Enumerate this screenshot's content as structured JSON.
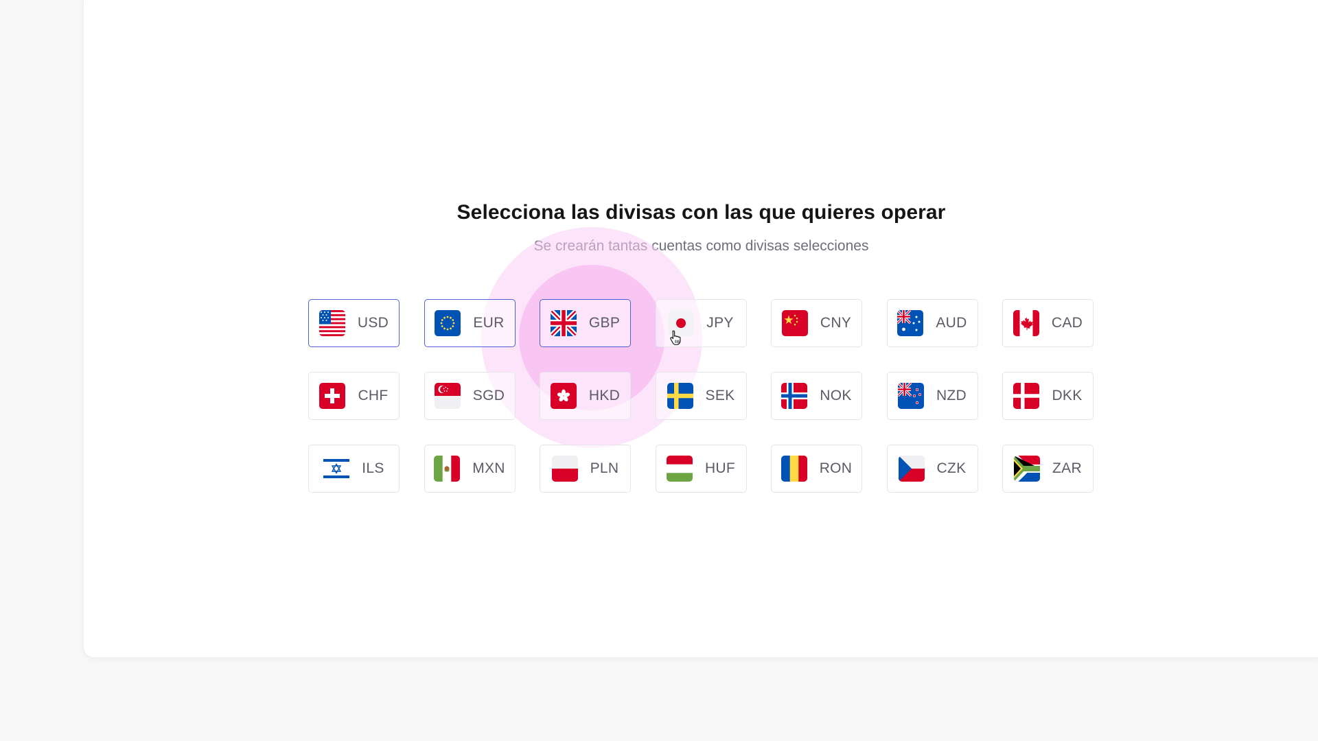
{
  "page": {
    "title": "Selecciona las divisas con las que quieres operar",
    "subtitle": "Se crearán tantas cuentas como divisas selecciones"
  },
  "colors": {
    "accent": "#4f5fd8",
    "highlight": "#f8b4f0"
  },
  "currencies": [
    {
      "code": "USD",
      "flag": "us-flag-icon",
      "selected": true
    },
    {
      "code": "EUR",
      "flag": "eu-flag-icon",
      "selected": true
    },
    {
      "code": "GBP",
      "flag": "gb-flag-icon",
      "selected": true
    },
    {
      "code": "JPY",
      "flag": "jp-flag-icon",
      "selected": false
    },
    {
      "code": "CNY",
      "flag": "cn-flag-icon",
      "selected": false
    },
    {
      "code": "AUD",
      "flag": "au-flag-icon",
      "selected": false
    },
    {
      "code": "CAD",
      "flag": "ca-flag-icon",
      "selected": false
    },
    {
      "code": "CHF",
      "flag": "ch-flag-icon",
      "selected": false
    },
    {
      "code": "SGD",
      "flag": "sg-flag-icon",
      "selected": false
    },
    {
      "code": "HKD",
      "flag": "hk-flag-icon",
      "selected": false
    },
    {
      "code": "SEK",
      "flag": "se-flag-icon",
      "selected": false
    },
    {
      "code": "NOK",
      "flag": "no-flag-icon",
      "selected": false
    },
    {
      "code": "NZD",
      "flag": "nz-flag-icon",
      "selected": false
    },
    {
      "code": "DKK",
      "flag": "dk-flag-icon",
      "selected": false
    },
    {
      "code": "ILS",
      "flag": "il-flag-icon",
      "selected": false
    },
    {
      "code": "MXN",
      "flag": "mx-flag-icon",
      "selected": false
    },
    {
      "code": "PLN",
      "flag": "pl-flag-icon",
      "selected": false
    },
    {
      "code": "HUF",
      "flag": "hu-flag-icon",
      "selected": false
    },
    {
      "code": "RON",
      "flag": "ro-flag-icon",
      "selected": false
    },
    {
      "code": "CZK",
      "flag": "cz-flag-icon",
      "selected": false
    },
    {
      "code": "ZAR",
      "flag": "za-flag-icon",
      "selected": false
    }
  ]
}
